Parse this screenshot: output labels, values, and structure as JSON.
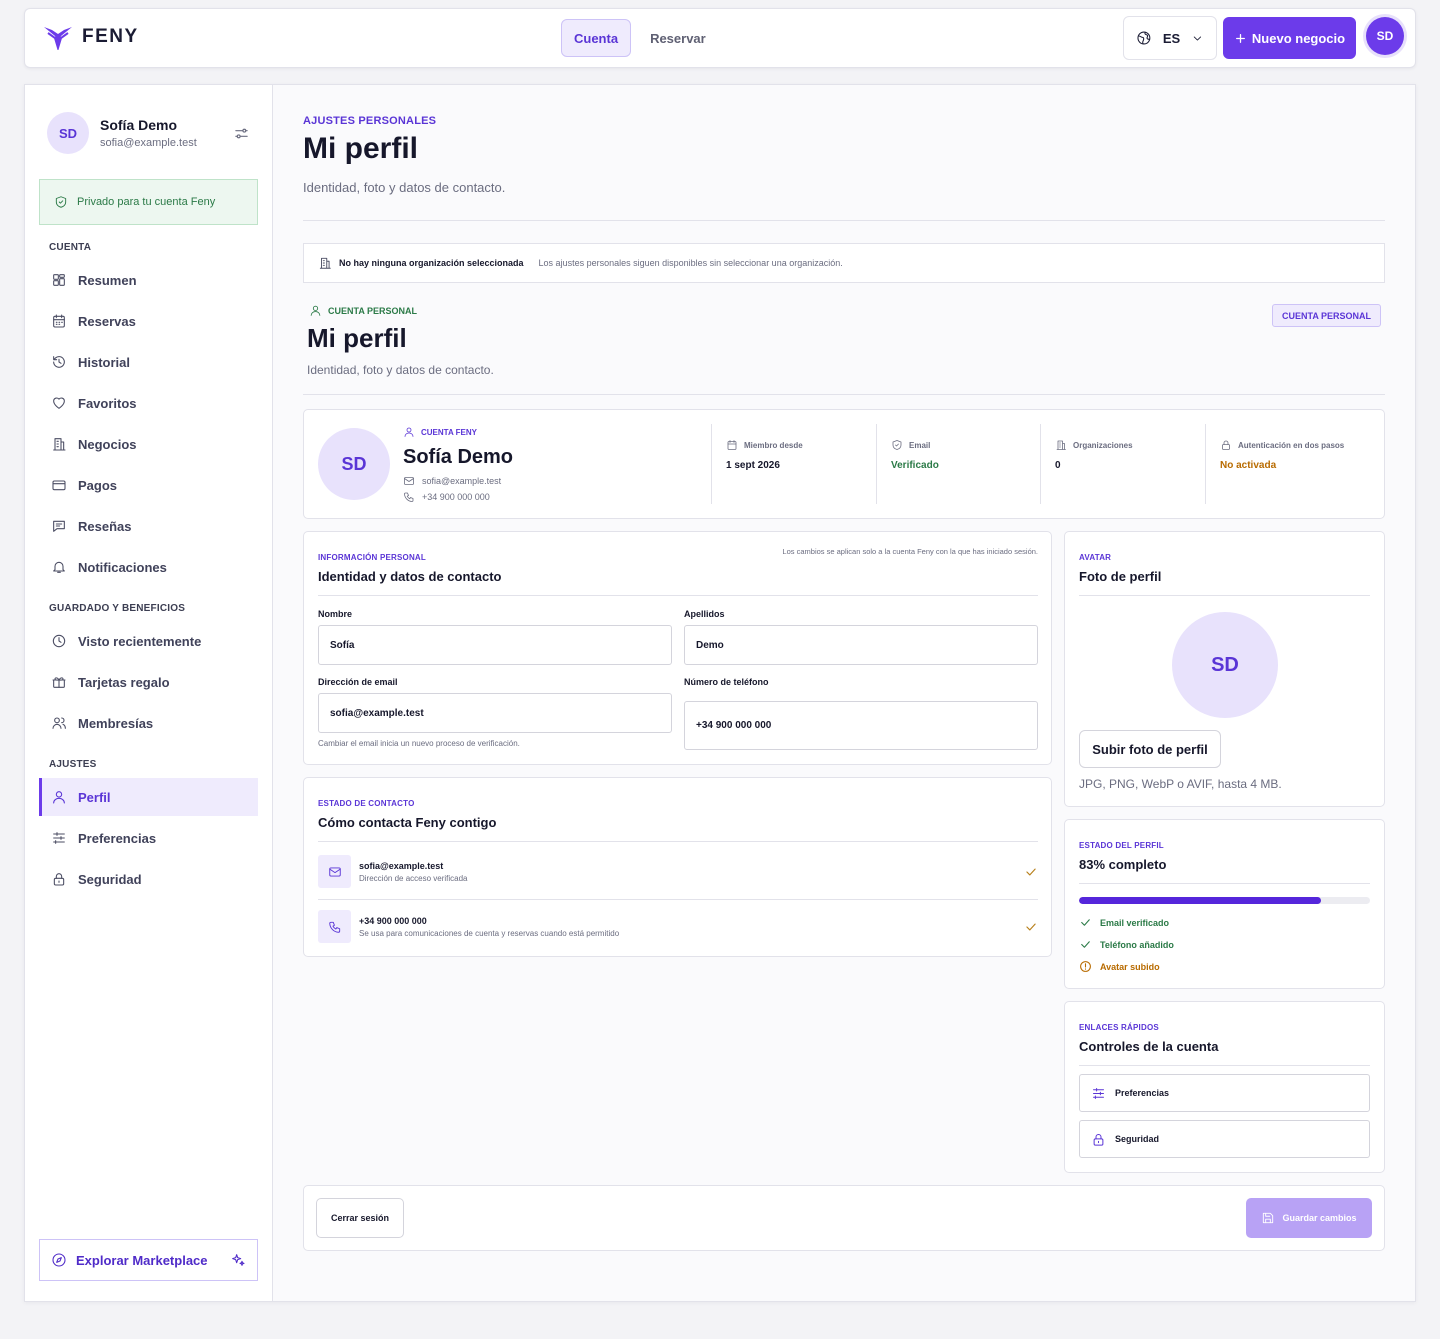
{
  "brand": {
    "name": "FENY",
    "color": "#6c3bea"
  },
  "topnav": {
    "tabs": [
      {
        "label": "Cuenta",
        "active": true
      },
      {
        "label": "Reservar",
        "active": false
      }
    ],
    "language": "ES",
    "new_business": "Nuevo negocio",
    "avatar_initials": "SD"
  },
  "sidebar": {
    "user": {
      "initials": "SD",
      "name": "Sofía Demo",
      "email": "sofia@example.test"
    },
    "privacy_note": "Privado para tu cuenta Feny",
    "sections": {
      "account": "CUENTA",
      "saved": "GUARDADO Y BENEFICIOS",
      "settings": "AJUSTES"
    },
    "account_items": [
      "Resumen",
      "Reservas",
      "Historial",
      "Favoritos",
      "Negocios",
      "Pagos",
      "Reseñas",
      "Notificaciones"
    ],
    "saved_items": [
      "Visto recientemente",
      "Tarjetas regalo",
      "Membresías"
    ],
    "settings_items": [
      "Perfil",
      "Preferencias",
      "Seguridad"
    ],
    "active_item": "Perfil",
    "explore": "Explorar Marketplace"
  },
  "header": {
    "eyebrow": "AJUSTES PERSONALES",
    "title": "Mi perfil",
    "subtitle": "Identidad, foto y datos de contacto."
  },
  "no_org": {
    "title": "No hay ninguna organización seleccionada",
    "text": "Los ajustes personales siguen disponibles sin seleccionar una organización."
  },
  "personal_account": {
    "eyebrow": "CUENTA PERSONAL",
    "title": "Mi perfil",
    "subtitle": "Identidad, foto y datos de contacto.",
    "badge": "CUENTA PERSONAL"
  },
  "profile_card": {
    "initials": "SD",
    "eyebrow": "CUENTA FENY",
    "name": "Sofía Demo",
    "email": "sofia@example.test",
    "phone": "+34 900 000 000",
    "stats": [
      {
        "label": "Miembro desde",
        "value": "1 sept 2026",
        "color": "#16172b"
      },
      {
        "label": "Email",
        "value": "Verificado",
        "color": "#2b7a47"
      },
      {
        "label": "Organizaciones",
        "value": "0",
        "color": "#16172b"
      },
      {
        "label": "Autenticación en dos pasos",
        "value": "No activada",
        "color": "#b86b00"
      }
    ]
  },
  "personal_info": {
    "eyebrow": "INFORMACIÓN PERSONAL",
    "title": "Identidad y datos de contacto",
    "note": "Los cambios se aplican solo a la cuenta Feny con la que has iniciado sesión.",
    "first_name_label": "Nombre",
    "first_name": "Sofía",
    "last_name_label": "Apellidos",
    "last_name": "Demo",
    "email_label": "Dirección de email",
    "email": "sofia@example.test",
    "phone_label": "Número de teléfono",
    "phone": "+34 900 000 000",
    "email_hint": "Cambiar el email inicia un nuevo proceso de verificación."
  },
  "contact_status": {
    "eyebrow": "ESTADO DE CONTACTO",
    "title": "Cómo contacta Feny contigo",
    "items": [
      {
        "value": "sofia@example.test",
        "desc": "Dirección de acceso verificada"
      },
      {
        "value": "+34 900 000 000",
        "desc": "Se usa para comunicaciones de cuenta y reservas cuando está permitido"
      }
    ]
  },
  "avatar_card": {
    "eyebrow": "AVATAR",
    "title": "Foto de perfil",
    "initials": "SD",
    "upload": "Subir foto de perfil",
    "hint": "JPG, PNG, WebP o AVIF, hasta 4 MB."
  },
  "profile_status": {
    "eyebrow": "ESTADO DEL PERFIL",
    "title": "83% completo",
    "progress": 0.83,
    "checks": [
      {
        "label": "Email verificado",
        "done": true
      },
      {
        "label": "Teléfono añadido",
        "done": true
      },
      {
        "label": "Avatar subido",
        "done": false
      }
    ]
  },
  "quick_links": {
    "eyebrow": "ENLACES RÁPIDOS",
    "title": "Controles de la cuenta",
    "items": [
      "Preferencias",
      "Seguridad"
    ]
  },
  "footer": {
    "logout": "Cerrar sesión",
    "save": "Guardar cambios"
  }
}
